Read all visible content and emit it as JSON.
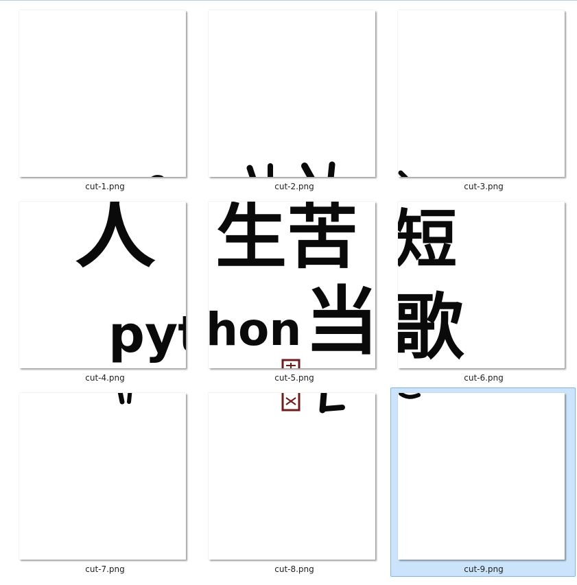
{
  "files": [
    {
      "name": "cut-1.png",
      "selected": false
    },
    {
      "name": "cut-2.png",
      "selected": false
    },
    {
      "name": "cut-3.png",
      "selected": false
    },
    {
      "name": "cut-4.png",
      "selected": false
    },
    {
      "name": "cut-5.png",
      "selected": false
    },
    {
      "name": "cut-6.png",
      "selected": false
    },
    {
      "name": "cut-7.png",
      "selected": false
    },
    {
      "name": "cut-8.png",
      "selected": false
    },
    {
      "name": "cut-9.png",
      "selected": true
    }
  ],
  "artwork": {
    "fragments": {
      "cut4_top": "人",
      "cut4_mid": "pyt",
      "cut5_top": "生苦",
      "cut5_mid": "hon",
      "cut5_char": "当",
      "cut6_top": "短",
      "cut6_mid": "歌"
    }
  },
  "colors": {
    "selection_bg": "#cce4fb",
    "selection_border": "#7eb4ea",
    "ink": "#0a0a0a",
    "seal": "#6e1c1c"
  }
}
